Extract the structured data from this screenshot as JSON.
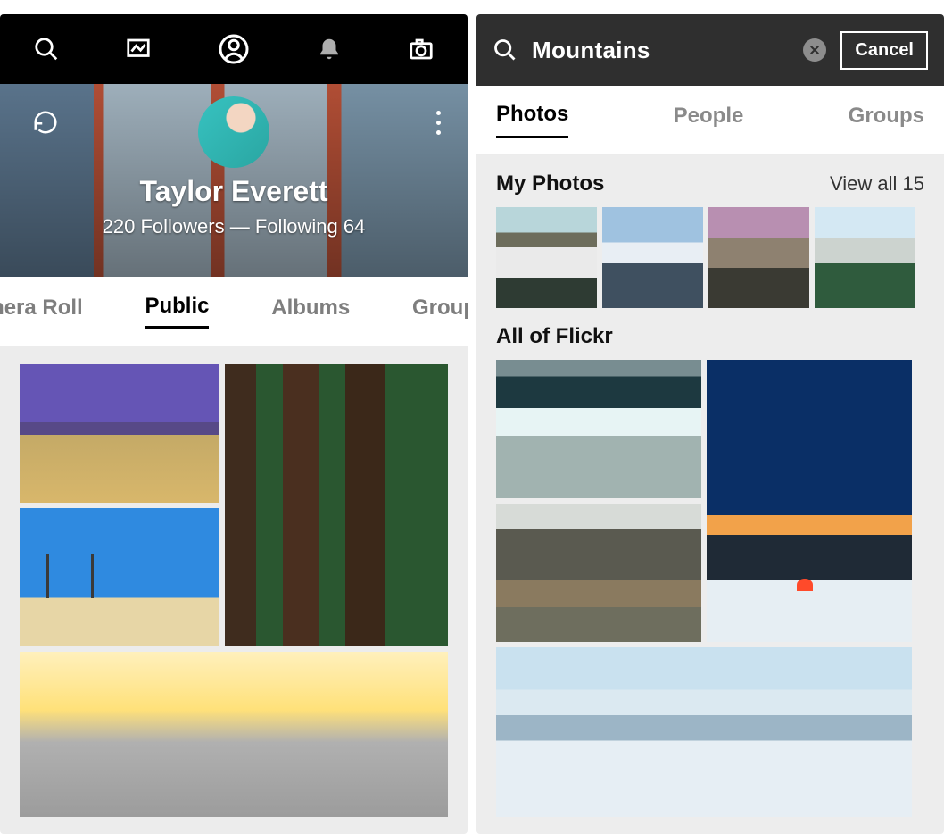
{
  "left": {
    "nav": {
      "icons": {
        "search": "search-icon",
        "feed": "feed-icon",
        "profile": "profile-icon",
        "notifications": "bell-icon",
        "camera": "camera-icon"
      }
    },
    "profile": {
      "name": "Taylor Everett",
      "followers_label": "220 Followers",
      "separator": "—",
      "following_label": "Following 64"
    },
    "tabs": {
      "camera_roll": "amera Roll",
      "public": "Public",
      "albums": "Albums",
      "groups": "Group"
    },
    "active_tab": "public"
  },
  "right": {
    "search": {
      "query": "Mountains",
      "cancel": "Cancel"
    },
    "tabs": {
      "photos": "Photos",
      "people": "People",
      "groups": "Groups"
    },
    "active_tab": "photos",
    "my_photos": {
      "title": "My Photos",
      "view_all": "View all 15"
    },
    "all_of_flickr": {
      "title": "All of Flickr"
    }
  }
}
